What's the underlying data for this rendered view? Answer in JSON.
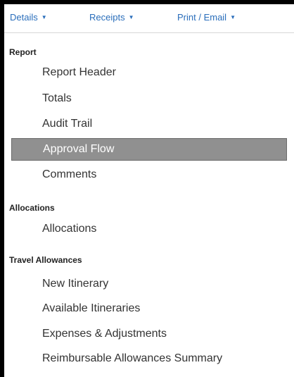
{
  "toolbar": {
    "tabs": [
      {
        "label": "Details",
        "caret": "▼"
      },
      {
        "label": "Receipts",
        "caret": "▼"
      },
      {
        "label": "Print / Email",
        "caret": "▼"
      }
    ]
  },
  "menu": {
    "sections": [
      {
        "title": "Report",
        "items": [
          "Report Header",
          "Totals",
          "Audit Trail",
          "Approval Flow",
          "Comments"
        ]
      },
      {
        "title": "Allocations",
        "items": [
          "Allocations"
        ]
      },
      {
        "title": "Travel Allowances",
        "items": [
          "New Itinerary",
          "Available Itineraries",
          "Expenses & Adjustments",
          "Reimbursable Allowances Summary"
        ]
      }
    ],
    "selected_item": "Approval Flow"
  },
  "colors": {
    "link": "#2a6ebb",
    "selected_background": "#909090",
    "selected_text": "#ffffff",
    "frame_border": "#000000"
  }
}
